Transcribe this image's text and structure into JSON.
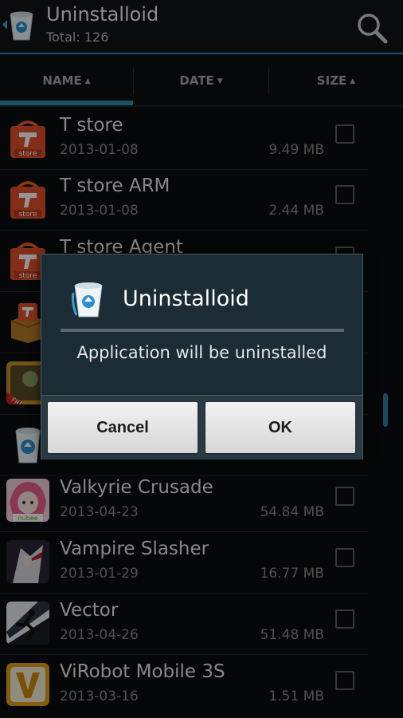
{
  "app": {
    "title": "Uninstalloid",
    "subtitle": "Total: 126",
    "icons": {
      "back": "back-arrow-icon",
      "app": "recycle-bin-icon",
      "search": "search-icon"
    }
  },
  "tabs": [
    {
      "label": "NAME",
      "arrow": "▲",
      "selected": true
    },
    {
      "label": "DATE",
      "arrow": "▼",
      "selected": false
    },
    {
      "label": "SIZE",
      "arrow": "▲",
      "selected": false
    }
  ],
  "rows": [
    {
      "name": "T store",
      "date": "2013-01-08",
      "size": "9.49 MB",
      "icon": "tstore-bag-icon"
    },
    {
      "name": "T store ARM",
      "date": "2013-01-08",
      "size": "2.44 MB",
      "icon": "tstore-bag-icon"
    },
    {
      "name": "T store Agent",
      "date": "",
      "size": "",
      "icon": "tstore-bag-icon"
    },
    {
      "name": "",
      "date": "",
      "size": "",
      "icon": "tstore-box-icon"
    },
    {
      "name": "",
      "date": "",
      "size": "",
      "icon": "game-free-icon"
    },
    {
      "name": "",
      "date": "",
      "size": "",
      "icon": "recycle-bin-icon"
    },
    {
      "name": "Valkyrie Crusade",
      "date": "2013-04-23",
      "size": "54.84 MB",
      "icon": "valkyrie-crusade-icon"
    },
    {
      "name": "Vampire Slasher",
      "date": "2013-01-29",
      "size": "16.77 MB",
      "icon": "vampire-slasher-icon"
    },
    {
      "name": "Vector",
      "date": "2013-04-26",
      "size": "51.48 MB",
      "icon": "vector-runner-icon"
    },
    {
      "name": "ViRobot Mobile 3S",
      "date": "2013-03-16",
      "size": "1.51 MB",
      "icon": "virobot-v-icon"
    }
  ],
  "dialog": {
    "title": "Uninstalloid",
    "message": "Application will be uninstalled",
    "cancel_label": "Cancel",
    "ok_label": "OK"
  },
  "colors": {
    "accent": "#2f8cb4",
    "background": "#0b0d0f",
    "dialog": "#1c2c36"
  }
}
